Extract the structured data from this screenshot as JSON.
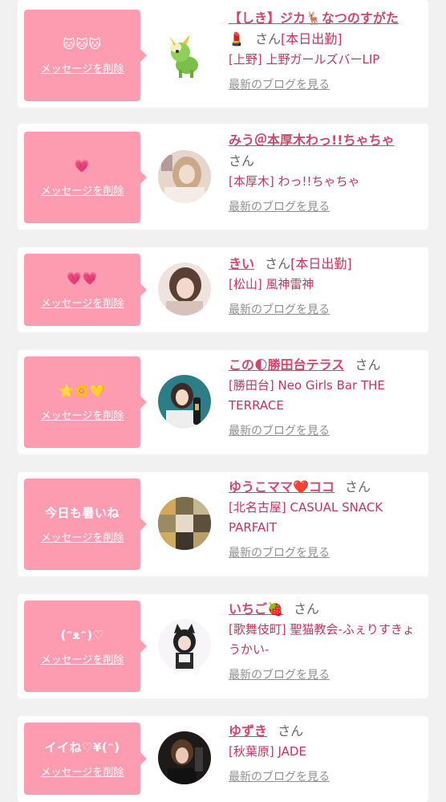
{
  "delete_label": "メッセージを削除",
  "blog_label": "最新のブログを見る",
  "honorific": "さん",
  "accent_color": "#fd9bb0",
  "name_color": "#d2466c",
  "cards": [
    {
      "message": "🐱🐱🐱",
      "name": "【しき】ジカ🦌なつのすがた",
      "name_icon_prefix": "💄",
      "status": "[本日出勤]",
      "shop": "[上野] 上野ガールズバーLIP",
      "avatar": "deer-character"
    },
    {
      "message": "💗",
      "name": "みう＠本厚木わっ!!ちゃちゃ",
      "status": "",
      "shop": "[本厚木] わっ!!ちゃちゃ",
      "avatar": "woman-photo"
    },
    {
      "message": "💗💗",
      "name": "きい",
      "status": "[本日出勤]",
      "shop": "[松山] 風神雷神",
      "avatar": "woman-photo"
    },
    {
      "message": "🌟🌼💛",
      "name": "この🌓勝田台テラス",
      "status": "",
      "shop": "[勝田台] Neo Girls Bar THE TERRACE",
      "avatar": "woman-with-bottle"
    },
    {
      "message": "今日も暑いね",
      "name": "ゆうこママ❤️ココ",
      "status": "",
      "shop": "[北名古屋] CASUAL SNACK PARFAIT",
      "avatar": "collage-photo"
    },
    {
      "message": "(ᵔᴥᵔ)♡",
      "name": "いちご🍓",
      "status": "",
      "shop": "[歌舞伎町] 聖猫教会-ふぇりすきょうかい-",
      "avatar": "cat-ear-girl"
    },
    {
      "message": "イイね♡¥(ᵔ)",
      "name": "ゆずき",
      "status": "",
      "shop": "[秋葉原] JADE",
      "avatar": "woman-photo"
    }
  ]
}
